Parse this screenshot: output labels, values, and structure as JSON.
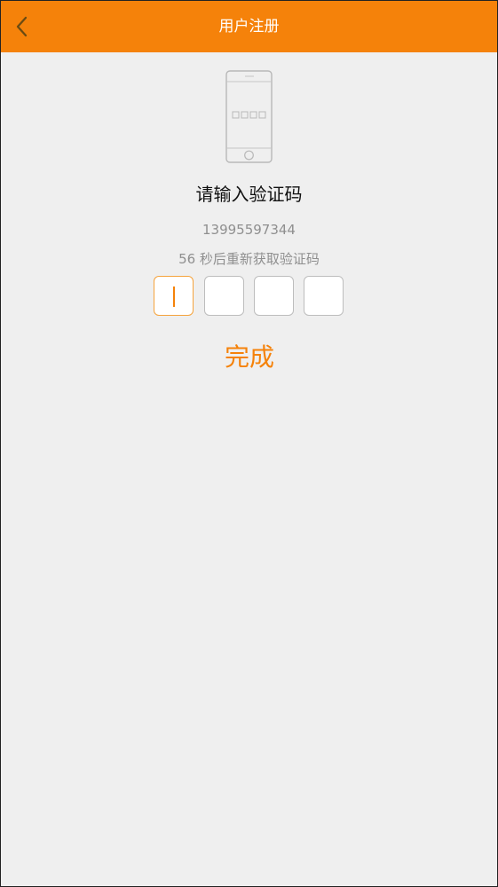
{
  "header": {
    "title": "用户注册",
    "back_icon": "chevron-left-icon"
  },
  "verification": {
    "illustration_icon": "phone-outline-icon",
    "heading": "请输入验证码",
    "phone_number": "13995597344",
    "resend_text": "56 秒后重新获取验证码",
    "code_boxes": [
      "",
      "",
      "",
      ""
    ]
  },
  "actions": {
    "done_label": "完成"
  },
  "colors": {
    "accent": "#f5820a",
    "background": "#efefef",
    "secondary_text": "#8f8f8f"
  }
}
